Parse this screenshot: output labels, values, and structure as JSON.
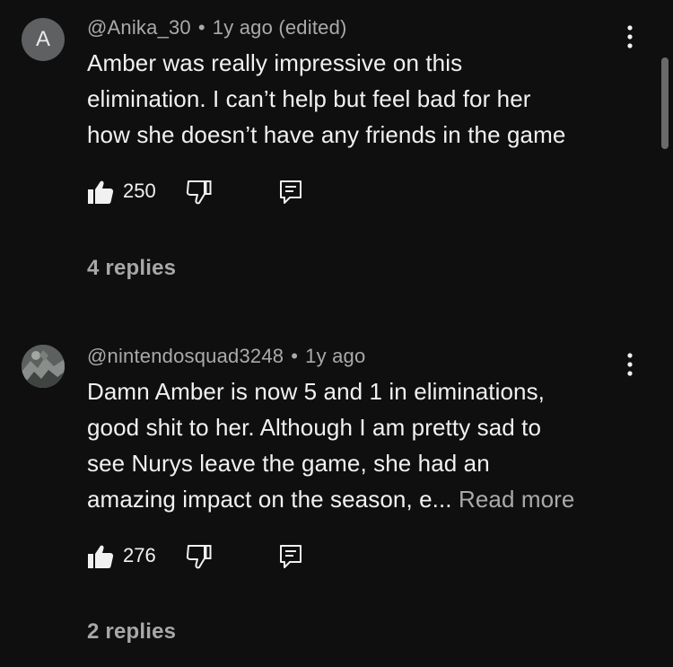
{
  "comments": [
    {
      "avatar_letter": "A",
      "author": "@Anika_30",
      "separator": "•",
      "timestamp": "1y ago (edited)",
      "lines": [
        "Amber was really impressive on this",
        "elimination. I can’t help but feel bad for her",
        "how she doesn’t have any friends in the game"
      ],
      "likes": "250",
      "replies": "4 replies"
    },
    {
      "author": "@nintendosquad3248",
      "separator": "•",
      "timestamp": "1y ago",
      "lines": [
        "Damn Amber is now 5 and 1 in eliminations,",
        "good shit to her. Although I am pretty sad to",
        "see Nurys leave the game, she had an",
        "amazing impact on the season, e..."
      ],
      "read_more": "Read more",
      "likes": "276",
      "replies": "2 replies"
    }
  ],
  "icons": {
    "like": "thumbs-up-icon",
    "dislike": "thumbs-down-icon",
    "reply": "reply-comment-icon",
    "more": "vertical-dots-icon"
  },
  "colors": {
    "background": "#0f0f0f",
    "primary_text": "#f1f1f1",
    "secondary_text": "#aaaaaa",
    "letter_avatar": "#5f6061"
  }
}
